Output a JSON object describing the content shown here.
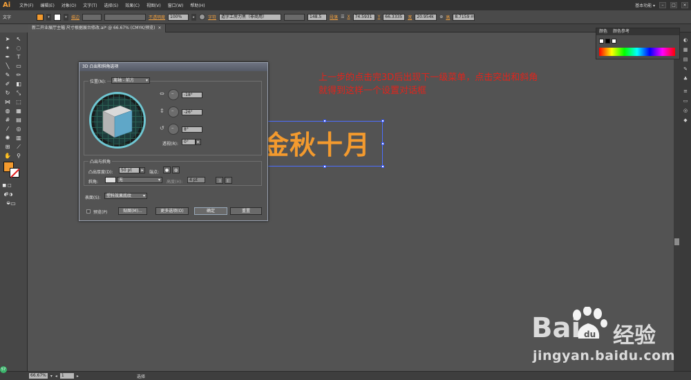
{
  "app": {
    "logo": "Ai"
  },
  "menu": [
    "文件(F)",
    "编辑(E)",
    "对象(O)",
    "文字(T)",
    "选择(S)",
    "效果(C)",
    "视图(V)",
    "窗口(W)",
    "帮助(H)"
  ],
  "workspace": {
    "label": "基本功能 ▾"
  },
  "window_buttons": [
    "–",
    "□",
    "×"
  ],
  "control_bar": {
    "tool_name": "文字",
    "stroke_label": "描边",
    "opacity_label": "不透明度",
    "opacity_value": "100%",
    "char_label": "字符",
    "font_name": "造字工房力黑（非商用）",
    "font_size": "148.5",
    "para_label": "段落",
    "x_label": "X",
    "x_value": "74.5931",
    "y_label": "Y",
    "y_value": "66.3335",
    "w_label": "宽",
    "w_value": "20.954k",
    "h_label": "高",
    "h_value": "8.7159 m",
    "fill_color": "#f39a2e"
  },
  "document_tab": {
    "title": "新二开业展厅主幅 尺寸根据展台修改.ai* @ 66.67% (CMYK/预览)",
    "close": "×"
  },
  "color_panel": {
    "tab_color": "颜色",
    "tab_guide": "颜色参考"
  },
  "artwork": {
    "text": "金秋十月",
    "text_color": "#f39a2e",
    "selection_color": "#4d6fff"
  },
  "annotation": {
    "line1": "上一步的点击完3D后出现下一级菜单，点击突出和斜角",
    "line2": "就得到这样一个设置对话框",
    "color": "#e0241c"
  },
  "dialog": {
    "title": "3D 凸出和斜角选项",
    "position_label": "位置(N):",
    "position_value": "离轴 - 前方",
    "rot_x": "-18°",
    "rot_y": "-26°",
    "rot_z": "8°",
    "perspective_label": "透视(R):",
    "perspective_value": "0°",
    "extrude_section": "凸出与斜角",
    "extrude_depth_label": "凸出厚度(D):",
    "extrude_depth_value": "50 pt",
    "cap_label": "端点:",
    "bevel_label": "斜角:",
    "bevel_value": "无",
    "height_label": "高度(H):",
    "height_value": "4 pt",
    "surface_label": "表面(S):",
    "surface_value": "塑料效果底纹",
    "preview_label": "预览(P)",
    "map_button": "贴图(M)...",
    "more_button": "更多选项(O)",
    "ok_button": "确定",
    "reset_button": "重置",
    "cube_front": "#5fa7c8",
    "cube_top": "#d9d9d9",
    "cube_side": "#b4b4b4"
  },
  "status_bar": {
    "zoom": "66.67%",
    "page": "1",
    "selection": "选择"
  },
  "watermark": {
    "brand": "Bai",
    "brand_suffix": "经验",
    "url": "jingyan.baidu.com"
  },
  "badge": {
    "text": "57"
  }
}
